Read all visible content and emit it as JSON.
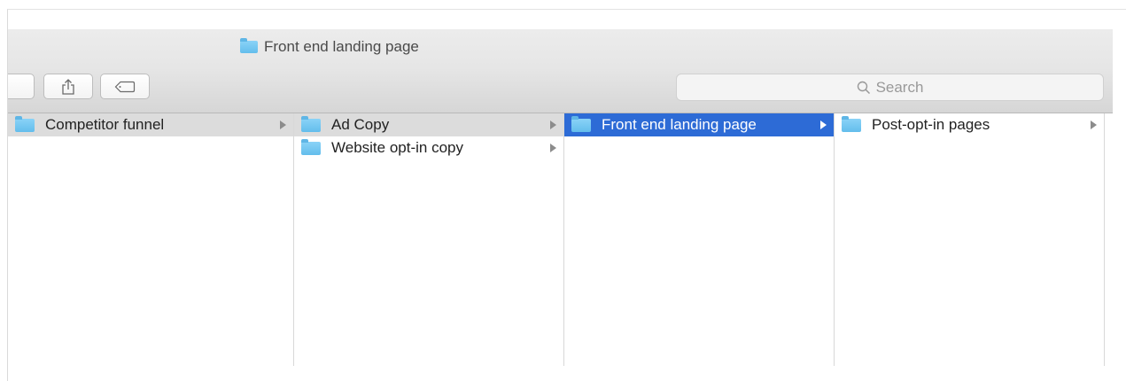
{
  "window": {
    "title": "Front end landing page"
  },
  "toolbar": {
    "share_icon": "share-icon",
    "tag_icon": "tag-icon",
    "search_placeholder": "Search"
  },
  "columns": [
    {
      "items": [
        {
          "label": "Competitor funnel",
          "selected": "inactive"
        }
      ]
    },
    {
      "items": [
        {
          "label": "Ad Copy",
          "selected": "inactive"
        },
        {
          "label": "Website opt-in copy",
          "selected": "none"
        }
      ]
    },
    {
      "items": [
        {
          "label": "Front end landing page",
          "selected": "active"
        }
      ]
    },
    {
      "items": [
        {
          "label": "Post-opt-in pages",
          "selected": "none"
        }
      ]
    }
  ],
  "colors": {
    "selection_active": "#2d6bd6",
    "selection_inactive": "#dcdcdc",
    "folder": "#6cc4f0"
  }
}
